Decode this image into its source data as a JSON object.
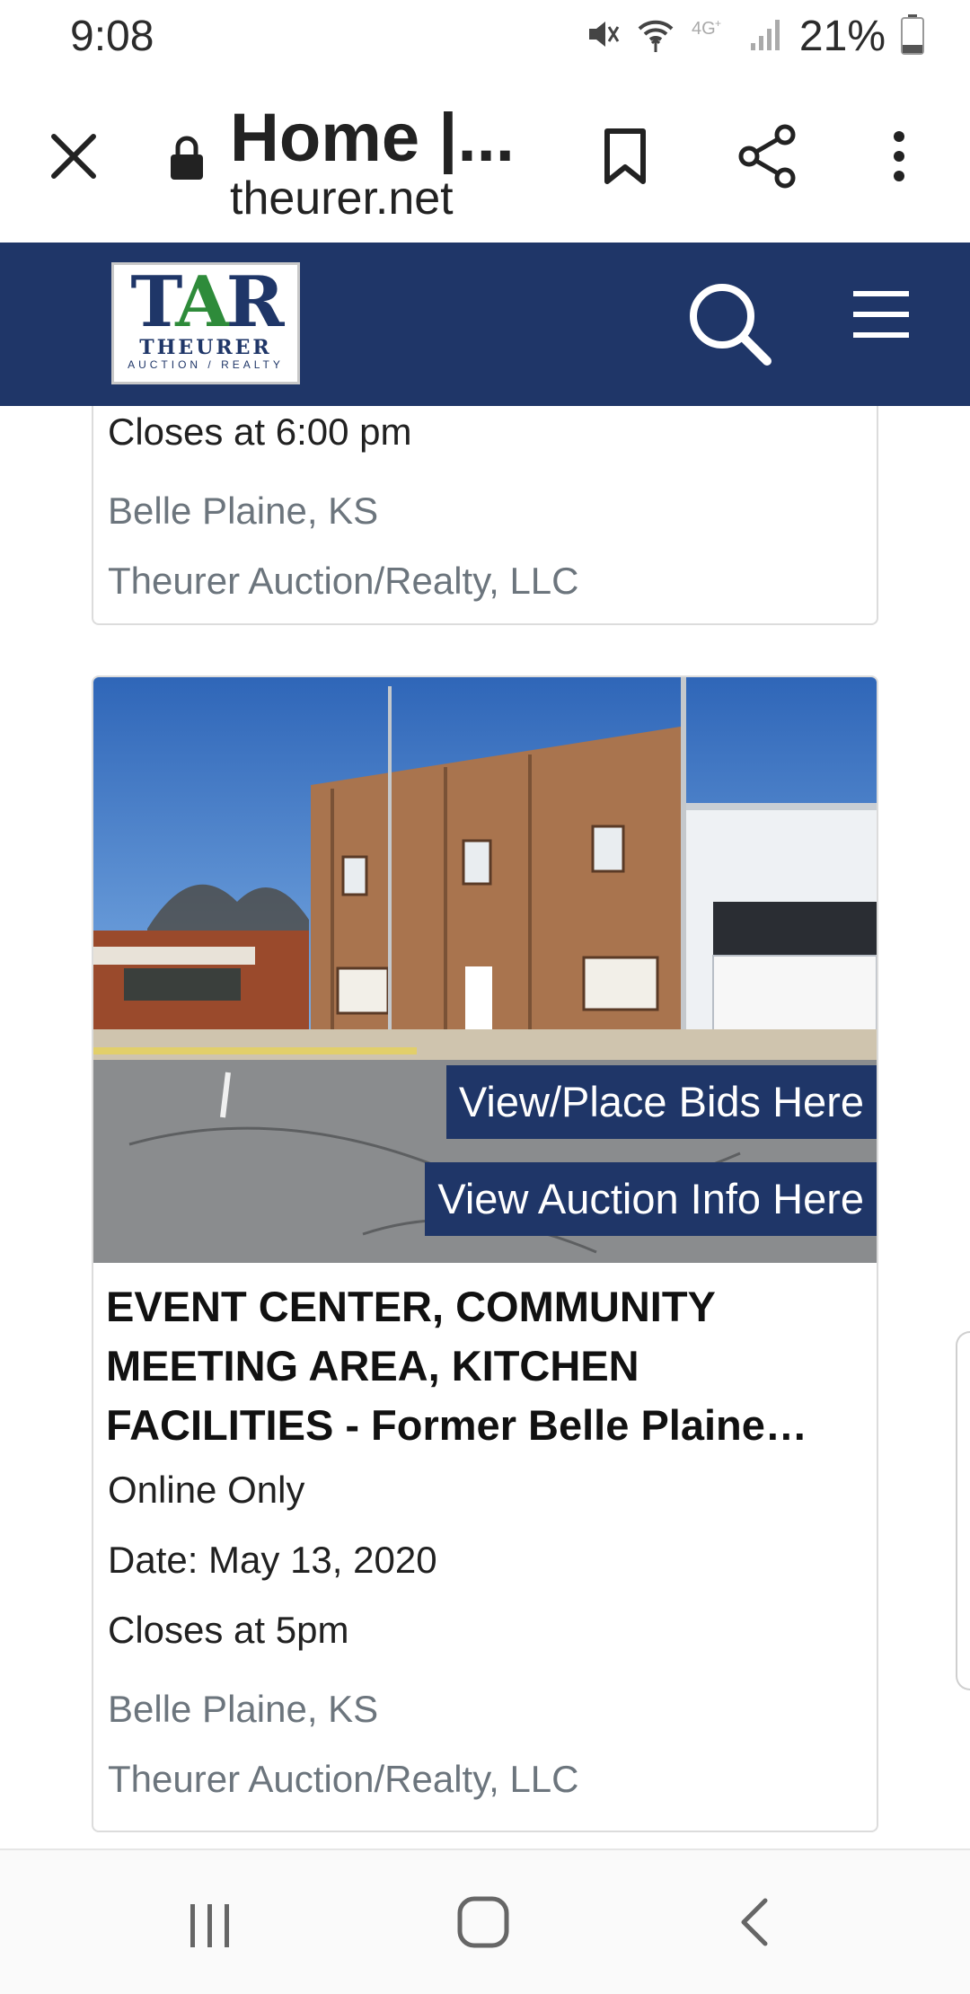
{
  "status_bar": {
    "time": "9:08",
    "battery_percent": "21%",
    "icons": [
      "mute-icon",
      "wifi-icon",
      "4g-icon",
      "signal-icon",
      "battery-icon"
    ]
  },
  "browser": {
    "page_title": "Home |...",
    "url": "theurer.net",
    "icons": [
      "close-icon",
      "lock-icon",
      "bookmark-icon",
      "share-icon",
      "more-vert-icon"
    ]
  },
  "site_header": {
    "logo_mark": "TAR",
    "logo_name": "THEURER",
    "logo_sub": "AUCTION / REALTY",
    "background": "#1f3668",
    "icons": [
      "search-icon",
      "hamburger-menu-icon"
    ]
  },
  "listings": [
    {
      "closes": "Closes at 6:00 pm",
      "location": "Belle Plaine, KS",
      "company": "Theurer Auction/Realty, LLC"
    },
    {
      "bid_button": "View/Place Bids Here",
      "info_button": "View Auction Info Here",
      "title": "EVENT CENTER, COMMUNITY MEETING AREA, KITCHEN FACILITIES - Former Belle Plaine…",
      "type": "Online Only",
      "date": "Date: May 13, 2020",
      "closes": "Closes at 5pm",
      "location": "Belle Plaine, KS",
      "company": "Theurer Auction/Realty, LLC"
    }
  ],
  "nav_bar": {
    "icons": [
      "recent-apps-icon",
      "home-icon",
      "back-icon"
    ]
  }
}
